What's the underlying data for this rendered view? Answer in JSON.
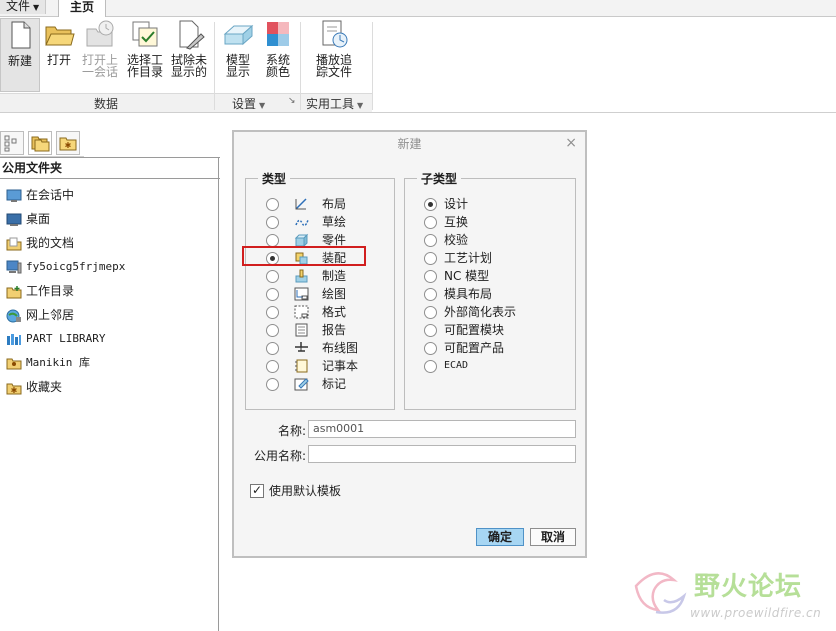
{
  "menu": {
    "file": "文件",
    "tab_home": "主页"
  },
  "ribbon": {
    "buttons": [
      {
        "label": "新建",
        "icon": "new-file-icon",
        "enabled": true
      },
      {
        "label": "打开",
        "icon": "open-folder-icon",
        "enabled": true
      },
      {
        "label": "打开上\n一会话",
        "icon": "open-last-session-icon",
        "enabled": false
      },
      {
        "label": "选择工\n作目录",
        "icon": "select-working-dir-icon",
        "enabled": true
      },
      {
        "label": "拭除未\n显示的",
        "icon": "erase-not-displayed-icon",
        "enabled": true
      },
      {
        "label": "模型\n显示",
        "icon": "model-display-icon",
        "enabled": true
      },
      {
        "label": "系统\n颜色",
        "icon": "system-colors-icon",
        "enabled": true
      },
      {
        "label": "播放追\n踪文件",
        "icon": "play-trail-file-icon",
        "enabled": true
      }
    ],
    "groups": {
      "data": "数据",
      "settings": "设置",
      "utilities": "实用工具"
    }
  },
  "left_panel": {
    "header": "公用文件夹",
    "items": [
      {
        "label": "在会话中",
        "icon": "in-session-icon",
        "mono": false
      },
      {
        "label": "桌面",
        "icon": "desktop-icon",
        "mono": false
      },
      {
        "label": "我的文档",
        "icon": "my-documents-icon",
        "mono": false
      },
      {
        "label": "fy5oicg5frjmepx",
        "icon": "computer-icon",
        "mono": true
      },
      {
        "label": "工作目录",
        "icon": "working-directory-icon",
        "mono": false
      },
      {
        "label": "网上邻居",
        "icon": "network-icon",
        "mono": false
      },
      {
        "label": "PART LIBRARY",
        "icon": "part-library-icon",
        "mono": true
      },
      {
        "label": "Manikin 库",
        "icon": "manikin-library-icon",
        "mono": true
      },
      {
        "label": "收藏夹",
        "icon": "favorites-icon",
        "mono": false
      }
    ]
  },
  "dialog": {
    "title": "新建",
    "close": "×",
    "type_legend": "类型",
    "subtype_legend": "子类型",
    "types": [
      {
        "label": "布局",
        "icon": "layout-icon",
        "selected": false
      },
      {
        "label": "草绘",
        "icon": "sketch-icon",
        "selected": false
      },
      {
        "label": "零件",
        "icon": "part-icon",
        "selected": false
      },
      {
        "label": "装配",
        "icon": "assembly-icon",
        "selected": true
      },
      {
        "label": "制造",
        "icon": "manufacturing-icon",
        "selected": false
      },
      {
        "label": "绘图",
        "icon": "drawing-icon",
        "selected": false
      },
      {
        "label": "格式",
        "icon": "format-icon",
        "selected": false
      },
      {
        "label": "报告",
        "icon": "report-icon",
        "selected": false
      },
      {
        "label": "布线图",
        "icon": "diagram-icon",
        "selected": false
      },
      {
        "label": "记事本",
        "icon": "notebook-icon",
        "selected": false
      },
      {
        "label": "标记",
        "icon": "markup-icon",
        "selected": false
      }
    ],
    "subtypes": [
      {
        "label": "设计",
        "selected": true,
        "mono": false
      },
      {
        "label": "互换",
        "selected": false,
        "mono": false
      },
      {
        "label": "校验",
        "selected": false,
        "mono": false
      },
      {
        "label": "工艺计划",
        "selected": false,
        "mono": false
      },
      {
        "label": "NC 模型",
        "selected": false,
        "mono": false
      },
      {
        "label": "模具布局",
        "selected": false,
        "mono": false
      },
      {
        "label": "外部简化表示",
        "selected": false,
        "mono": false
      },
      {
        "label": "可配置模块",
        "selected": false,
        "mono": false
      },
      {
        "label": "可配置产品",
        "selected": false,
        "mono": false
      },
      {
        "label": "ECAD",
        "selected": false,
        "mono": true
      }
    ],
    "name_label": "名称:",
    "name_value": "asm0001",
    "common_name_label": "公用名称:",
    "common_name_value": "",
    "use_default_template": "使用默认模板",
    "use_default_template_checked": true,
    "ok": "确定",
    "cancel": "取消"
  },
  "watermark": {
    "text": "野火论坛",
    "url": "www.proewildfire.cn"
  },
  "colors": {
    "accent": "#a7d6f3",
    "highlight": "#d11e1e",
    "watermark": "#b6df98"
  }
}
